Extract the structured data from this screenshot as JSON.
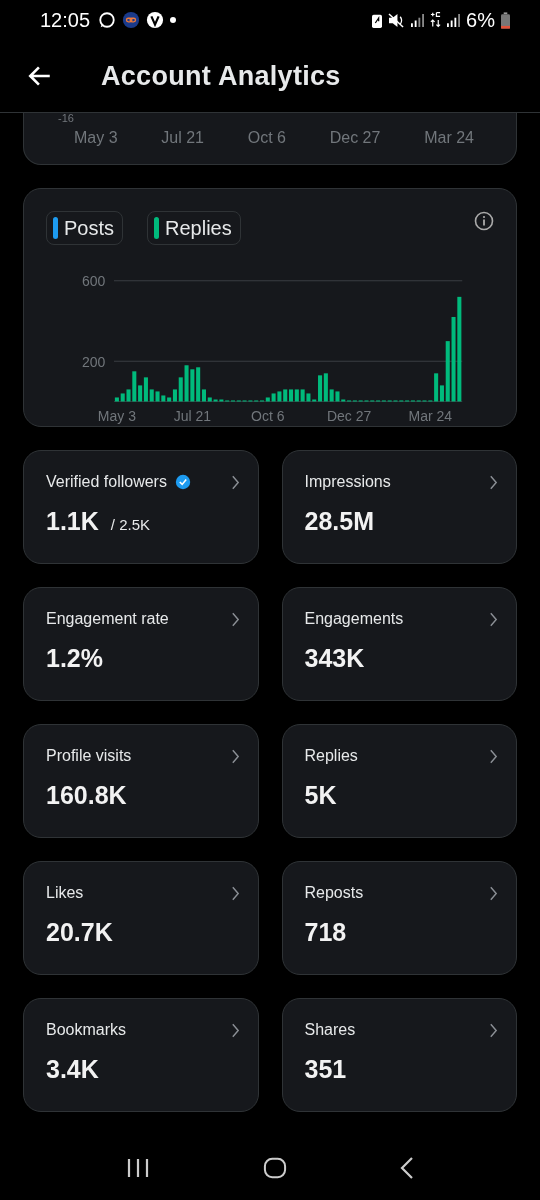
{
  "status_bar": {
    "time": "12:05",
    "battery": "6%"
  },
  "header": {
    "title": "Account Analytics"
  },
  "previous_chart": {
    "y_label": "-16",
    "x_labels": [
      "May 3",
      "Jul 21",
      "Oct 6",
      "Dec 27",
      "Mar 24"
    ]
  },
  "activity_chart": {
    "chart_data": {
      "type": "bar",
      "yticks": [
        200,
        600
      ],
      "ylim": [
        0,
        600
      ],
      "categories": [
        "May 3",
        null,
        null,
        null,
        null,
        null,
        null,
        null,
        null,
        null,
        null,
        null,
        null,
        "Jul 21",
        null,
        null,
        null,
        null,
        null,
        null,
        null,
        null,
        null,
        null,
        null,
        null,
        "Oct 6",
        null,
        null,
        null,
        null,
        null,
        null,
        null,
        null,
        null,
        null,
        null,
        null,
        null,
        "Dec 27",
        null,
        null,
        null,
        null,
        null,
        null,
        null,
        null,
        null,
        null,
        null,
        null,
        null,
        "Mar 24",
        null,
        null,
        null,
        null,
        null
      ],
      "series": [
        {
          "name": "Posts",
          "color": "#1d9bf0",
          "values": [
            null,
            null,
            null,
            null,
            null,
            null,
            null,
            null,
            null,
            null,
            null,
            null,
            null,
            null,
            null,
            null,
            null,
            null,
            null,
            null,
            null,
            null,
            null,
            null,
            null,
            null,
            null,
            null,
            null,
            null,
            null,
            null,
            null,
            null,
            null,
            null,
            null,
            null,
            null,
            null,
            null,
            null,
            null,
            null,
            null,
            null,
            null,
            null,
            null,
            null,
            null,
            null,
            null,
            null,
            null,
            null,
            null,
            null,
            null,
            null
          ]
        },
        {
          "name": "Replies",
          "color": "#00ba7c",
          "values": [
            20,
            40,
            60,
            150,
            80,
            120,
            60,
            50,
            30,
            20,
            60,
            120,
            180,
            160,
            170,
            60,
            20,
            10,
            10,
            5,
            0,
            0,
            0,
            0,
            0,
            0,
            20,
            40,
            50,
            60,
            60,
            60,
            60,
            40,
            10,
            130,
            140,
            60,
            50,
            10,
            0,
            0,
            0,
            0,
            0,
            0,
            0,
            0,
            0,
            0,
            0,
            0,
            0,
            0,
            0,
            140,
            80,
            300,
            420,
            520
          ]
        }
      ]
    }
  },
  "metrics": [
    {
      "label": "Verified followers",
      "verified": true,
      "value": "1.1K",
      "total": "/ 2.5K"
    },
    {
      "label": "Impressions",
      "verified": false,
      "value": "28.5M"
    },
    {
      "label": "Engagement rate",
      "verified": false,
      "value": "1.2%"
    },
    {
      "label": "Engagements",
      "verified": false,
      "value": "343K"
    },
    {
      "label": "Profile visits",
      "verified": false,
      "value": "160.8K"
    },
    {
      "label": "Replies",
      "verified": false,
      "value": "5K"
    },
    {
      "label": "Likes",
      "verified": false,
      "value": "20.7K"
    },
    {
      "label": "Reposts",
      "verified": false,
      "value": "718"
    },
    {
      "label": "Bookmarks",
      "verified": false,
      "value": "3.4K"
    },
    {
      "label": "Shares",
      "verified": false,
      "value": "351"
    }
  ]
}
